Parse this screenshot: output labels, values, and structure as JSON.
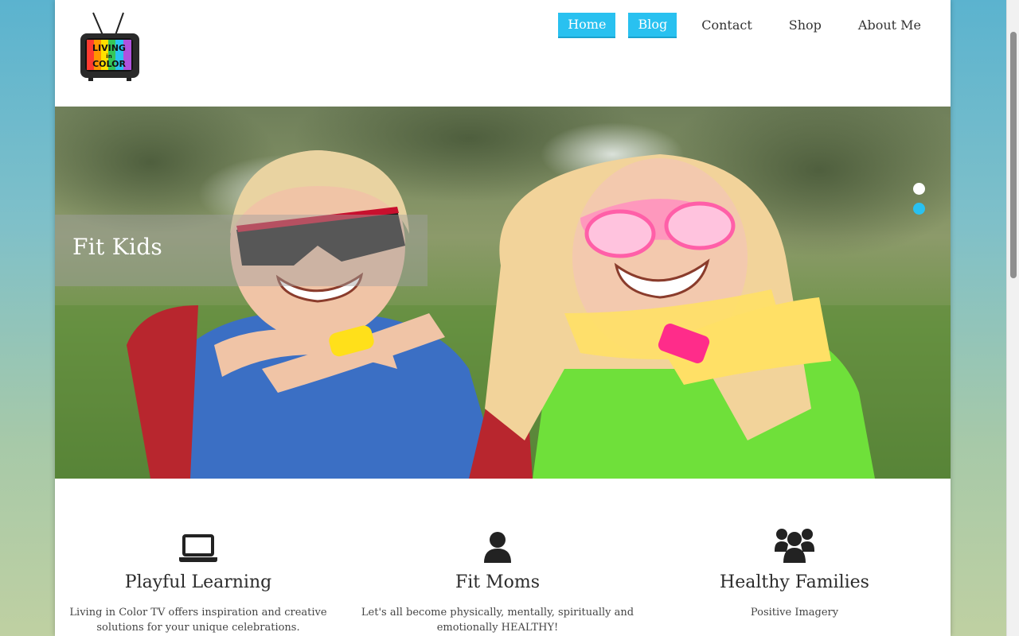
{
  "header": {
    "logo": {
      "icon": "retro-tv-logo-icon",
      "text_lines": [
        "LIVING",
        "in",
        "COLOR"
      ]
    },
    "nav": [
      {
        "label": "Home",
        "active": true
      },
      {
        "label": "Blog",
        "active": true
      },
      {
        "label": "Contact",
        "active": false
      },
      {
        "label": "Shop",
        "active": false
      },
      {
        "label": "About Me",
        "active": false
      }
    ]
  },
  "hero": {
    "caption": "Fit Kids",
    "slides": [
      {
        "active": false
      },
      {
        "active": true
      }
    ],
    "image": "photo-two-children-in-costumes-laughing-in-park"
  },
  "features": [
    {
      "icon": "laptop-icon",
      "title": "Playful Learning",
      "text": "Living in Color TV offers inspiration and creative solutions for your unique celebrations."
    },
    {
      "icon": "user-icon",
      "title": "Fit Moms",
      "text": "Let's all become physically, mentally, spiritually and emotionally HEALTHY!"
    },
    {
      "icon": "users-group-icon",
      "title": "Healthy Families",
      "text": "Positive Imagery"
    }
  ],
  "colors": {
    "accent": "#29c1f0",
    "background_top": "#5bb3cf",
    "background_bottom": "#bfd0a2",
    "text": "#2b2b2b"
  }
}
